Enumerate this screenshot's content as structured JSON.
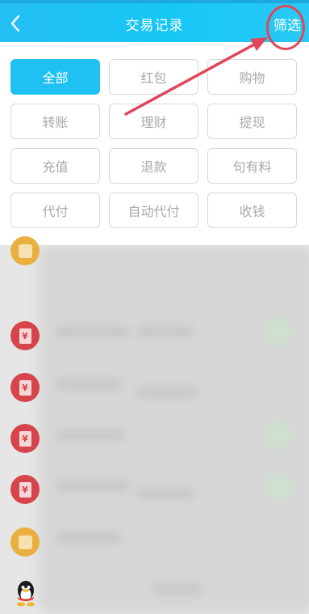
{
  "header": {
    "title": "交易记录",
    "filter_label": "筛选"
  },
  "filters": [
    {
      "label": "全部",
      "active": true
    },
    {
      "label": "红包",
      "active": false
    },
    {
      "label": "购物",
      "active": false
    },
    {
      "label": "转账",
      "active": false
    },
    {
      "label": "理财",
      "active": false
    },
    {
      "label": "提现",
      "active": false
    },
    {
      "label": "充值",
      "active": false
    },
    {
      "label": "退款",
      "active": false
    },
    {
      "label": "句有料",
      "active": false
    },
    {
      "label": "代付",
      "active": false
    },
    {
      "label": "自动代付",
      "active": false
    },
    {
      "label": "收钱",
      "active": false
    }
  ],
  "list_icons": [
    "shopping-bag-icon",
    "red-packet-icon",
    "red-packet-icon",
    "red-packet-icon",
    "red-packet-icon",
    "shopping-bag-icon",
    "qq-penguin-icon"
  ],
  "red_packet_symbol": "¥",
  "colors": {
    "header": "#1fc1f3",
    "active_chip": "#1fc1f3",
    "annotation": "#e0465b",
    "red_packet": "#d6454c",
    "shopping": "#e9b041"
  }
}
